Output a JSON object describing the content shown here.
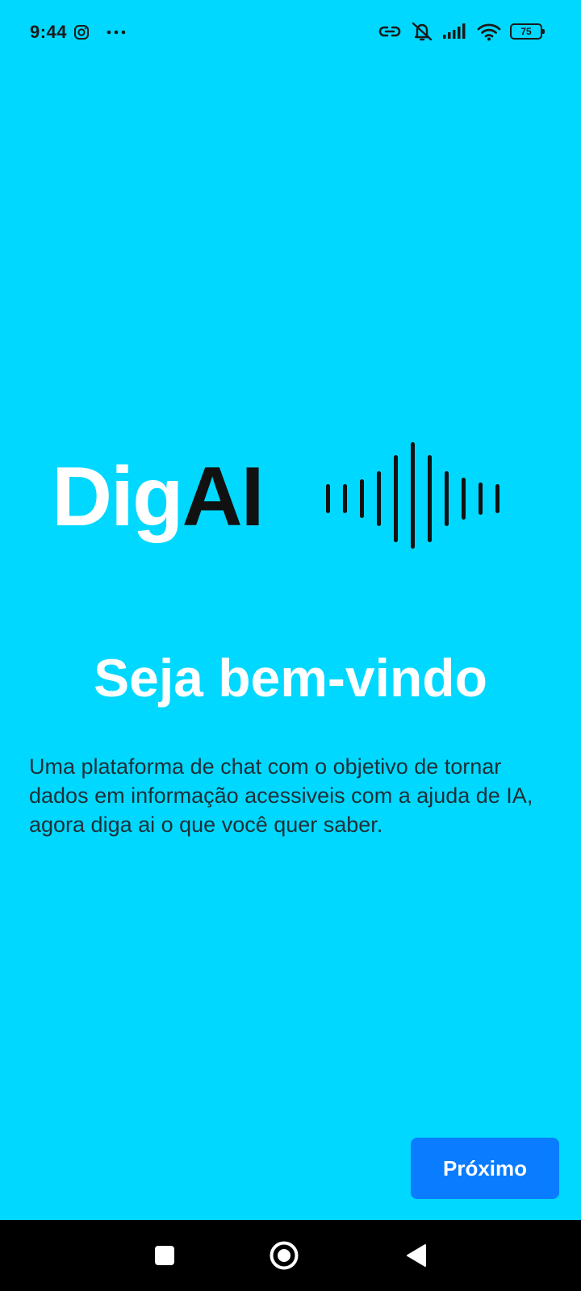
{
  "status_bar": {
    "time": "9:44",
    "battery_level": "75",
    "icons": [
      "instagram-icon",
      "more-dots-icon",
      "link-icon",
      "silent-mode-icon",
      "signal-icon",
      "wifi-icon",
      "battery-icon"
    ]
  },
  "logo": {
    "part1": "Dig",
    "part2": "AI",
    "icon": "sound-wave-icon"
  },
  "welcome": {
    "title": "Seja bem-vindo",
    "description": "Uma plataforma de chat com o objetivo de tornar dados em informação acessiveis com a ajuda de IA, agora diga ai o que você quer saber."
  },
  "actions": {
    "next_label": "Próximo"
  },
  "nav_bar": {
    "items": [
      "recents-square-icon",
      "home-circle-icon",
      "back-triangle-icon"
    ]
  },
  "colors": {
    "background": "#00D8FF",
    "logo_primary": "#FFFFFF",
    "logo_accent": "#111111",
    "button": "#0A7CFF",
    "nav_bar": "#000000"
  }
}
